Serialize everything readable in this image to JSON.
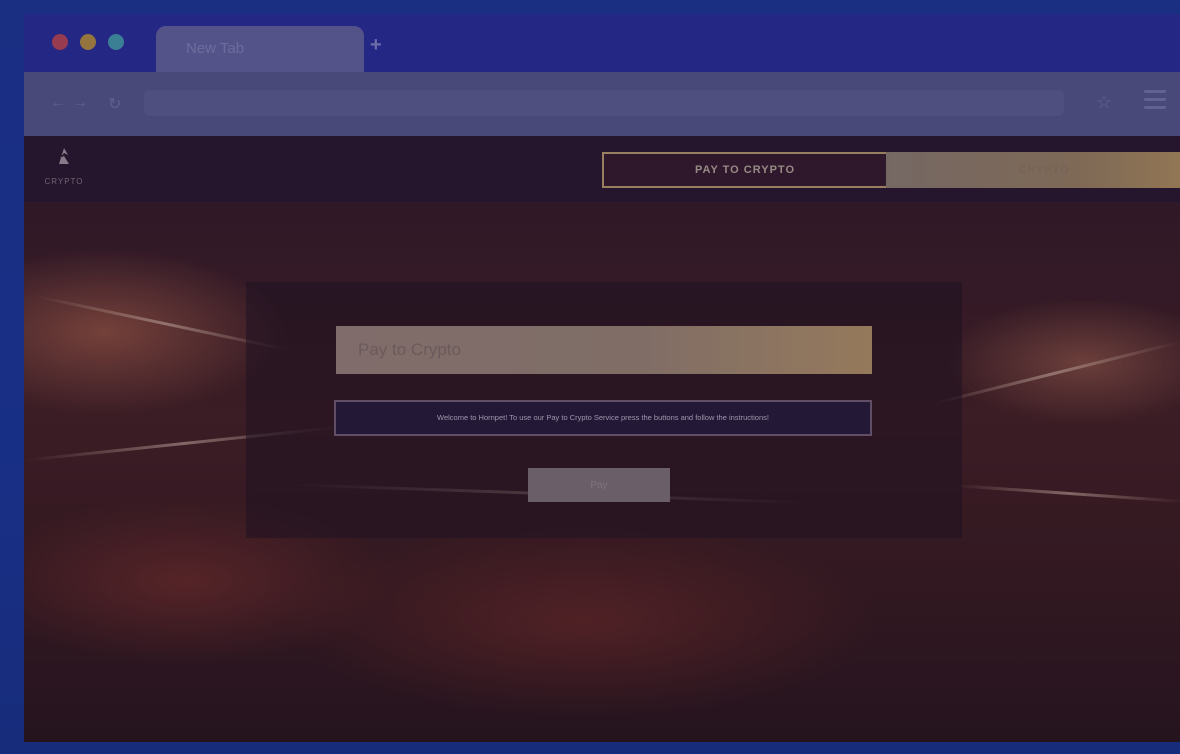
{
  "browser": {
    "tab_title": "New Tab",
    "new_tab_symbol": "+"
  },
  "site": {
    "logo_text": "CRYPTO",
    "nav": {
      "active_tab": "PAY TO CRYPTO",
      "second_tab": "CRYPTO"
    },
    "form": {
      "title": "Pay to Crypto",
      "welcome_text": "Welcome to Hornpet! To use our Pay to Crypto Service press the buttons and follow the instructions!",
      "pay_button": "Pay"
    }
  },
  "colors": {
    "tab_bar": "#2b2f9e",
    "accent_gold": "#c7a065",
    "header_bg": "#2b1624"
  }
}
